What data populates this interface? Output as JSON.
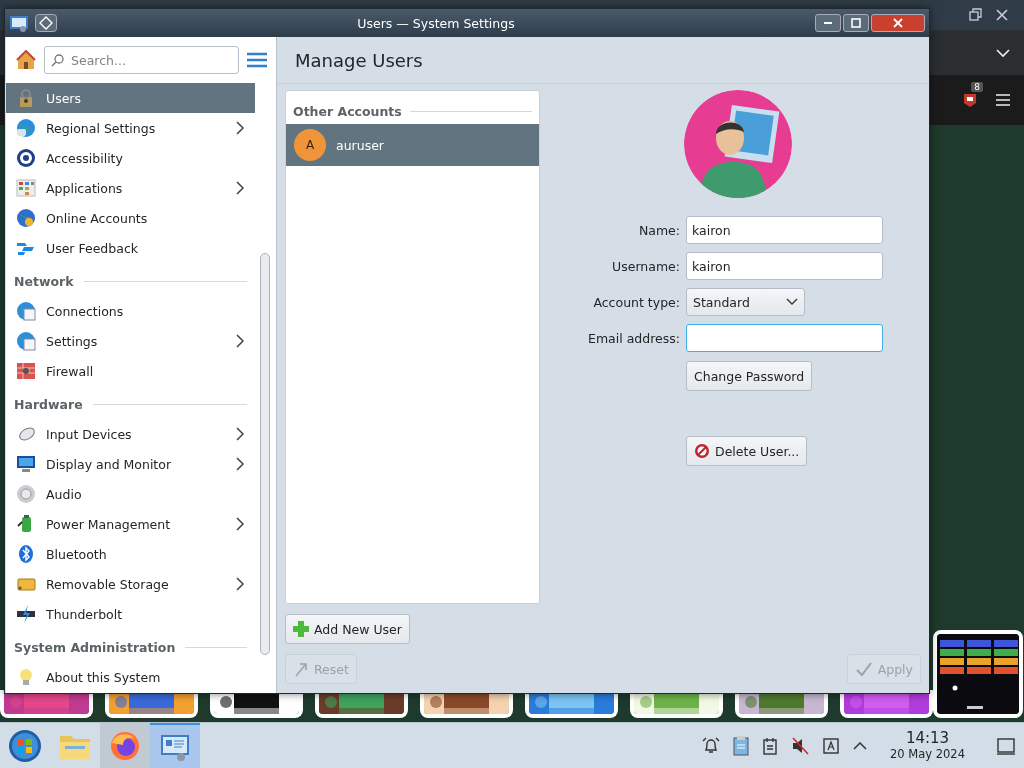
{
  "window": {
    "title": "Users — System Settings"
  },
  "sidebar": {
    "search": {
      "placeholder": "Search..."
    },
    "items": [
      {
        "kind": "item",
        "label": "Users",
        "selected": true,
        "has_children": false
      },
      {
        "kind": "item",
        "label": "Regional Settings",
        "selected": false,
        "has_children": true
      },
      {
        "kind": "item",
        "label": "Accessibility",
        "selected": false,
        "has_children": false
      },
      {
        "kind": "item",
        "label": "Applications",
        "selected": false,
        "has_children": true
      },
      {
        "kind": "item",
        "label": "Online Accounts",
        "selected": false,
        "has_children": false
      },
      {
        "kind": "item",
        "label": "User Feedback",
        "selected": false,
        "has_children": false
      },
      {
        "kind": "header",
        "label": "Network"
      },
      {
        "kind": "item",
        "label": "Connections",
        "selected": false,
        "has_children": false
      },
      {
        "kind": "item",
        "label": "Settings",
        "selected": false,
        "has_children": true
      },
      {
        "kind": "item",
        "label": "Firewall",
        "selected": false,
        "has_children": false
      },
      {
        "kind": "header",
        "label": "Hardware"
      },
      {
        "kind": "item",
        "label": "Input Devices",
        "selected": false,
        "has_children": true
      },
      {
        "kind": "item",
        "label": "Display and Monitor",
        "selected": false,
        "has_children": true
      },
      {
        "kind": "item",
        "label": "Audio",
        "selected": false,
        "has_children": false
      },
      {
        "kind": "item",
        "label": "Power Management",
        "selected": false,
        "has_children": true
      },
      {
        "kind": "item",
        "label": "Bluetooth",
        "selected": false,
        "has_children": false
      },
      {
        "kind": "item",
        "label": "Removable Storage",
        "selected": false,
        "has_children": true
      },
      {
        "kind": "item",
        "label": "Thunderbolt",
        "selected": false,
        "has_children": false
      },
      {
        "kind": "header",
        "label": "System Administration"
      },
      {
        "kind": "item",
        "label": "About this System",
        "selected": false,
        "has_children": false
      }
    ]
  },
  "page": {
    "title": "Manage Users"
  },
  "accounts": {
    "header": "Other Accounts",
    "users": [
      {
        "initial": "A",
        "name": "auruser",
        "selected": true
      }
    ]
  },
  "form": {
    "fields": [
      {
        "kind": "text",
        "label": "Name:",
        "value": "kairon",
        "focused": false
      },
      {
        "kind": "text",
        "label": "Username:",
        "value": "kairon",
        "focused": false
      },
      {
        "kind": "select",
        "label": "Account type:",
        "value": "Standard"
      },
      {
        "kind": "text",
        "label": "Email address:",
        "focused": true
      }
    ],
    "change_password": "Change Password",
    "delete_user": "Delete User..."
  },
  "add_user": {
    "label": "Add New User"
  },
  "footer": {
    "reset": {
      "label": "Reset",
      "disabled": true
    },
    "apply": {
      "label": "Apply",
      "disabled": true
    }
  },
  "background": {
    "badge": "8"
  },
  "taskbar": {
    "time": "14:13",
    "date": "20 May 2024"
  }
}
